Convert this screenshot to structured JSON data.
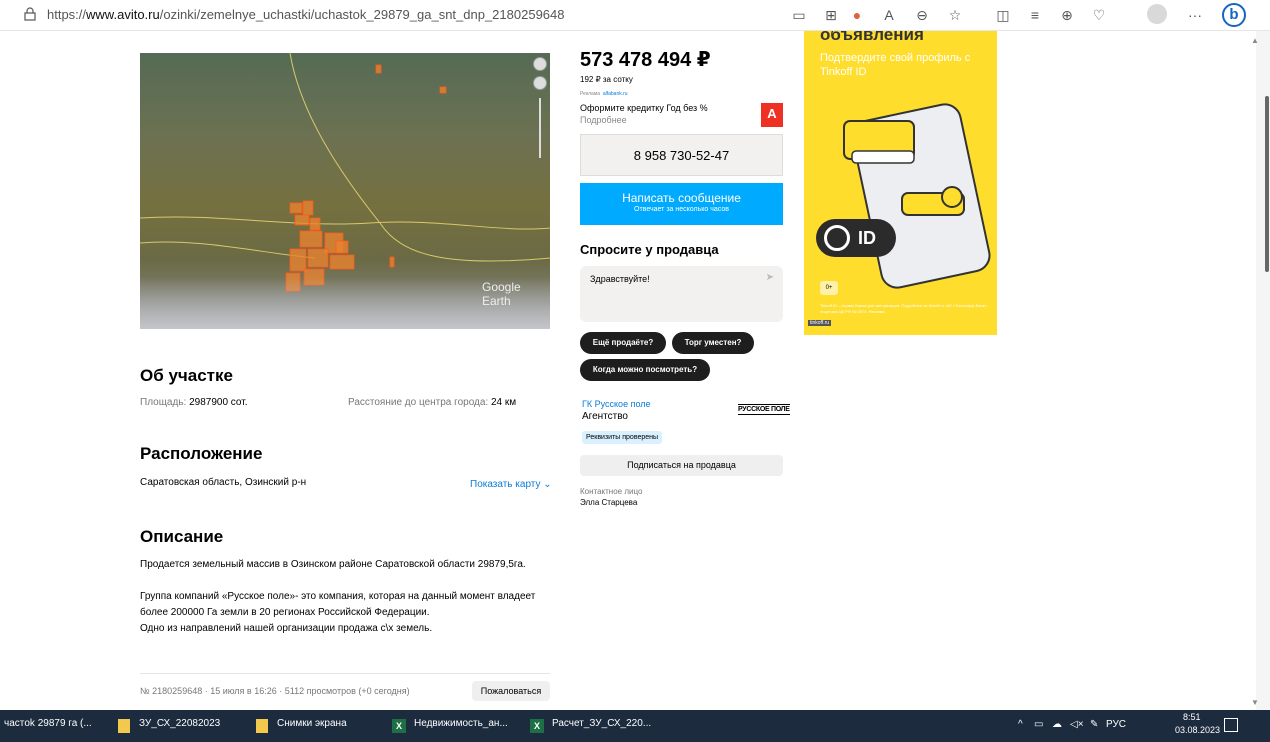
{
  "browser": {
    "url_prefix": "https://",
    "url_domain": "www.avito.ru",
    "url_path": "/ozinki/zemelnye_uchastki/uchastok_29879_ga_snt_dnp_2180259648"
  },
  "listing": {
    "price": "573 478 494 ₽",
    "price_per": "192 ₽ за сотку",
    "ad_label": "Реклама",
    "ad_domain": "alfabank.ru",
    "ad_title": "Оформите кредитку Год без %",
    "ad_more": "Подробнее",
    "alfa_letter": "А",
    "phone": "8 958 730-52-47",
    "message_button": "Написать сообщение",
    "message_sub": "Отвечает за несколько часов",
    "ask_title": "Спросите у продавца",
    "ask_text": "Здравствуйте!",
    "chips": [
      "Ещё продаёте?",
      "Торг уместен?",
      "Когда можно посмотреть?"
    ],
    "seller_name": "ГК Русское поле",
    "seller_type": "Агентство",
    "seller_logo": "РУССКОЕ ПОЛЕ",
    "verified": "Реквизиты проверены",
    "subscribe": "Подписаться на продавца",
    "contact_label": "Контактное лицо",
    "contact_name": "Элла Старцева"
  },
  "about": {
    "title": "Об участке",
    "area_label": "Площадь:",
    "area_value": "2987900 сот.",
    "distance_label": "Расстояние до центра города:",
    "distance_value": "24 км"
  },
  "location": {
    "title": "Расположение",
    "address": "Саратовская область, Озинский р-н",
    "show_map": "Показать карту"
  },
  "description": {
    "title": "Описание",
    "p1": "Продается земельный массив в Озинском районе Саратовской области 29879,5га.",
    "p2_l1": "Группа компаний «Русское поле»- это компания, которая на данный момент владеет",
    "p2_l2": "более 200000 Га земли в 20 регионах Российской Федерации.",
    "p2_l3": "Одно из направлений нашей организации продажа с\\х земель."
  },
  "footer": {
    "meta": "№ 2180259648 · 15 июля в 16:26 · 5112 просмотров (+0 сегодня)",
    "complain": "Пожаловаться"
  },
  "map": {
    "watermark": "Google Earth"
  },
  "banner": {
    "heading": "объявления",
    "sub": "Подтвердите свой профиль с Tinkoff ID",
    "id_text": "ID",
    "age": "0+",
    "small": "Tinkoff ID – сервис Банка для авторизации. Подробнее на tinkoff.ru. АО «Тинькофф Банк», лицензия ЦБ РФ № 2673. Реклама.",
    "link": "tinkoff.ru"
  },
  "taskbar": {
    "items": [
      "частok 29879 га (...",
      "ЗУ_СХ_22082023",
      "Снимки экрана",
      "Недвижимость_ан...",
      "Расчет_ЗУ_СХ_220..."
    ],
    "lang": "РУС",
    "time": "8:51",
    "date": "03.08.2023"
  },
  "colors": {
    "accent": "#00aaff",
    "banner": "#ffdd2d",
    "alfa": "#ef3124",
    "link": "#0a7bd8"
  }
}
